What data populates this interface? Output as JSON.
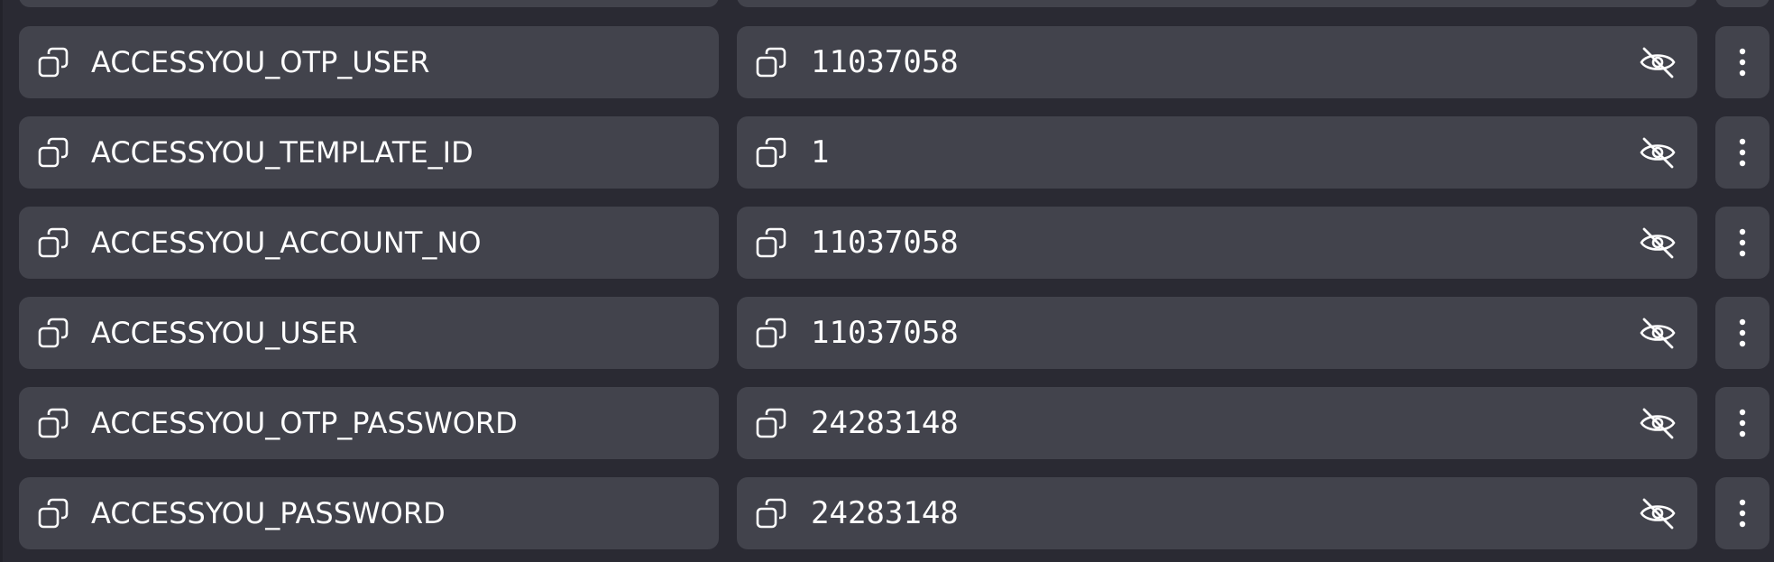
{
  "variables": [
    {
      "key": "ACCESSYOU_OTP_USER",
      "value": "11037058"
    },
    {
      "key": "ACCESSYOU_TEMPLATE_ID",
      "value": "1"
    },
    {
      "key": "ACCESSYOU_ACCOUNT_NO",
      "value": "11037058"
    },
    {
      "key": "ACCESSYOU_USER",
      "value": "11037058"
    },
    {
      "key": "ACCESSYOU_OTP_PASSWORD",
      "value": "24283148"
    },
    {
      "key": "ACCESSYOU_PASSWORD",
      "value": "24283148"
    }
  ],
  "icons": {
    "copy": "copy-icon",
    "visibility": "eye-off-icon",
    "menu": "more-vertical-icon"
  },
  "colors": {
    "background": "#2a2a33",
    "cell": "#42434c",
    "text": "#ffffff"
  }
}
